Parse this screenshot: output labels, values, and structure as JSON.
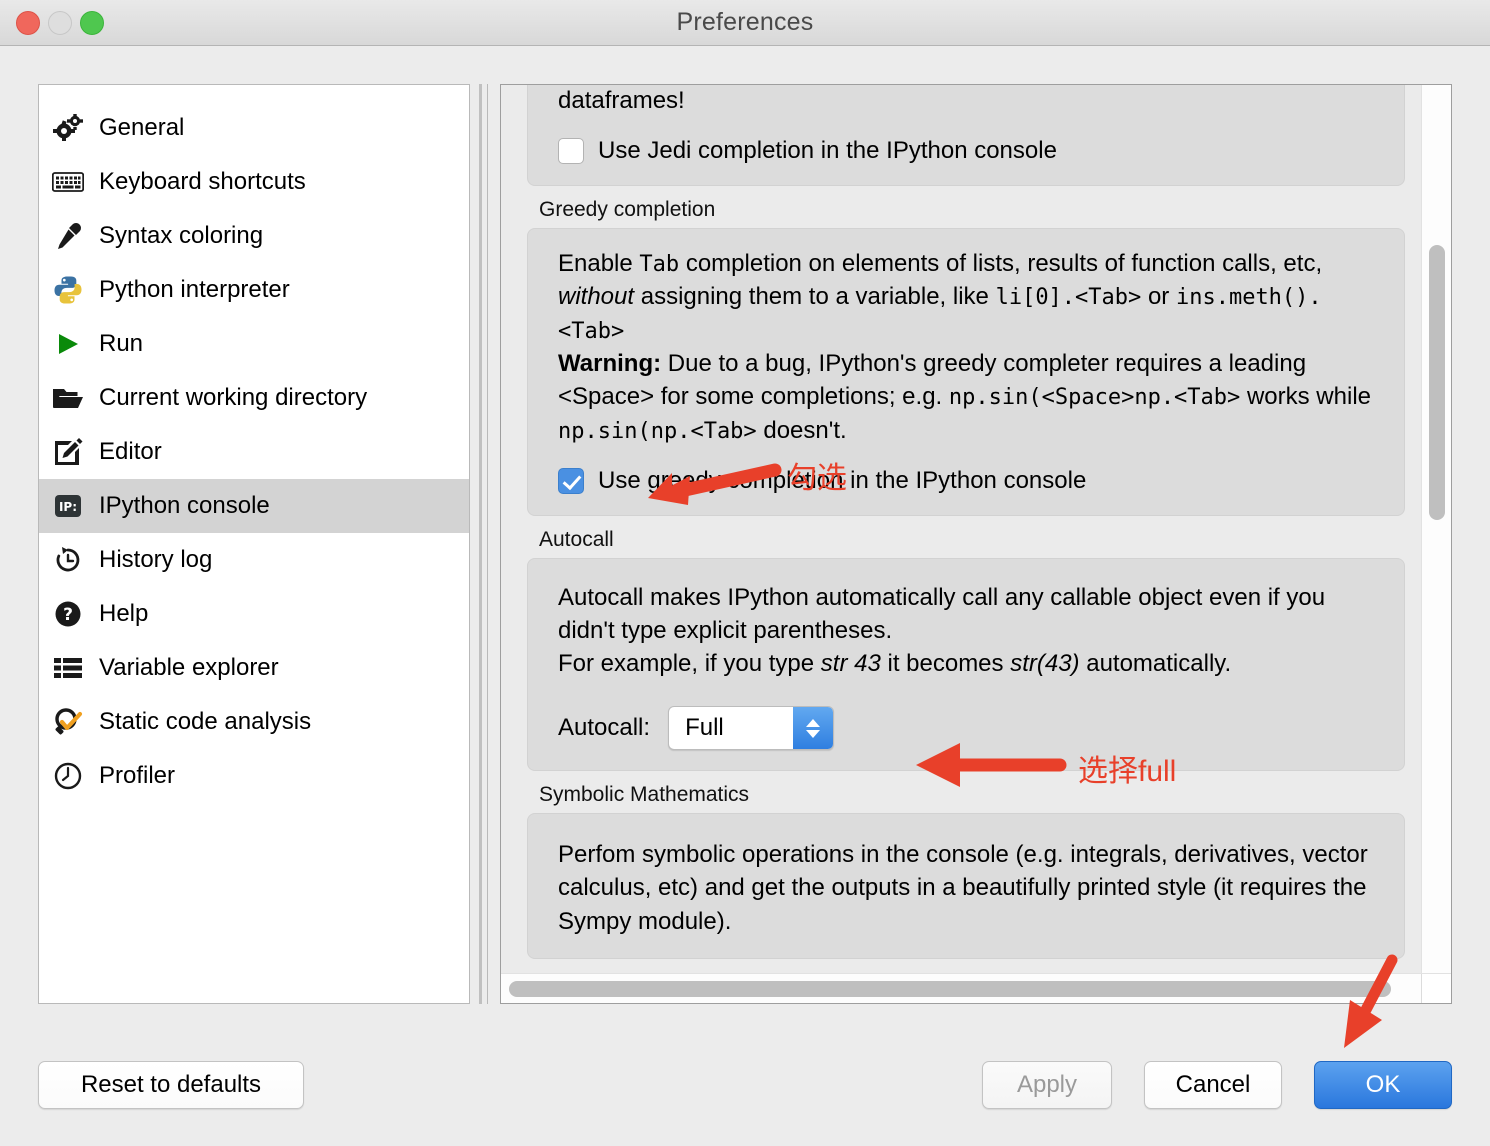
{
  "window": {
    "title": "Preferences",
    "controls": {
      "close": "close-button",
      "minimize": "minimize-button",
      "zoom": "zoom-button"
    }
  },
  "sidebar": {
    "items": [
      {
        "label": "General",
        "icon": "gears-icon",
        "selected": false
      },
      {
        "label": "Keyboard shortcuts",
        "icon": "keyboard-icon",
        "selected": false
      },
      {
        "label": "Syntax coloring",
        "icon": "eyedropper-icon",
        "selected": false
      },
      {
        "label": "Python interpreter",
        "icon": "python-icon",
        "selected": false
      },
      {
        "label": "Run",
        "icon": "play-icon",
        "selected": false
      },
      {
        "label": "Current working directory",
        "icon": "folder-open-icon",
        "selected": false
      },
      {
        "label": "Editor",
        "icon": "edit-pencil-icon",
        "selected": false
      },
      {
        "label": "IPython console",
        "icon": "ipython-icon",
        "selected": true
      },
      {
        "label": "History log",
        "icon": "history-clock-icon",
        "selected": false
      },
      {
        "label": "Help",
        "icon": "question-circle-icon",
        "selected": false
      },
      {
        "label": "Variable explorer",
        "icon": "table-list-icon",
        "selected": false
      },
      {
        "label": "Static code analysis",
        "icon": "check-magnifier-icon",
        "selected": false
      },
      {
        "label": "Profiler",
        "icon": "clock-icon",
        "selected": false
      }
    ]
  },
  "content": {
    "jedi_group": {
      "tail_text": "dataframes!",
      "checkbox_label": "Use Jedi completion in the IPython console",
      "checked": false
    },
    "greedy_group": {
      "title": "Greedy completion",
      "line1_a": "Enable ",
      "line1_tab": "Tab",
      "line1_b": " completion on elements of lists, results of function calls, etc, ",
      "line1_em": "without",
      "line1_c": " assigning them to a variable, like ",
      "line1_code": "li[0].<Tab>",
      "line1_d": " or ",
      "line1_code2": "ins.meth().<Tab>",
      "warning_label": "Warning:",
      "warning_text": " Due to a bug, IPython's greedy completer requires a leading <Space> for some completions; e.g. ",
      "warning_code1": "np.sin(<Space>np.<Tab>",
      "warning_mid": " works while ",
      "warning_code2": "np.sin(np.<Tab>",
      "warning_end": " doesn't.",
      "checkbox_label": "Use greedy completion in the IPython console",
      "checked": true
    },
    "autocall_group": {
      "title": "Autocall",
      "desc_line1": "Autocall makes IPython automatically call any callable object even if you didn't type explicit parentheses.",
      "desc_line2_a": "For example, if you type ",
      "desc_line2_em1": "str 43",
      "desc_line2_b": " it becomes ",
      "desc_line2_em2": "str(43)",
      "desc_line2_c": " automatically.",
      "field_label": "Autocall:",
      "value": "Full",
      "options": [
        "Full"
      ]
    },
    "symbolic_group": {
      "title": "Symbolic Mathematics",
      "desc": "Perfom symbolic operations in the console (e.g. integrals, derivatives, vector calculus, etc) and get the outputs in a beautifully printed style (it requires the Sympy module)."
    }
  },
  "footer": {
    "reset": "Reset to defaults",
    "apply": "Apply",
    "cancel": "Cancel",
    "ok": "OK"
  },
  "annotations": {
    "color": "#e8402a",
    "checkbox_note": "勾选",
    "autocall_note": "选择full"
  }
}
